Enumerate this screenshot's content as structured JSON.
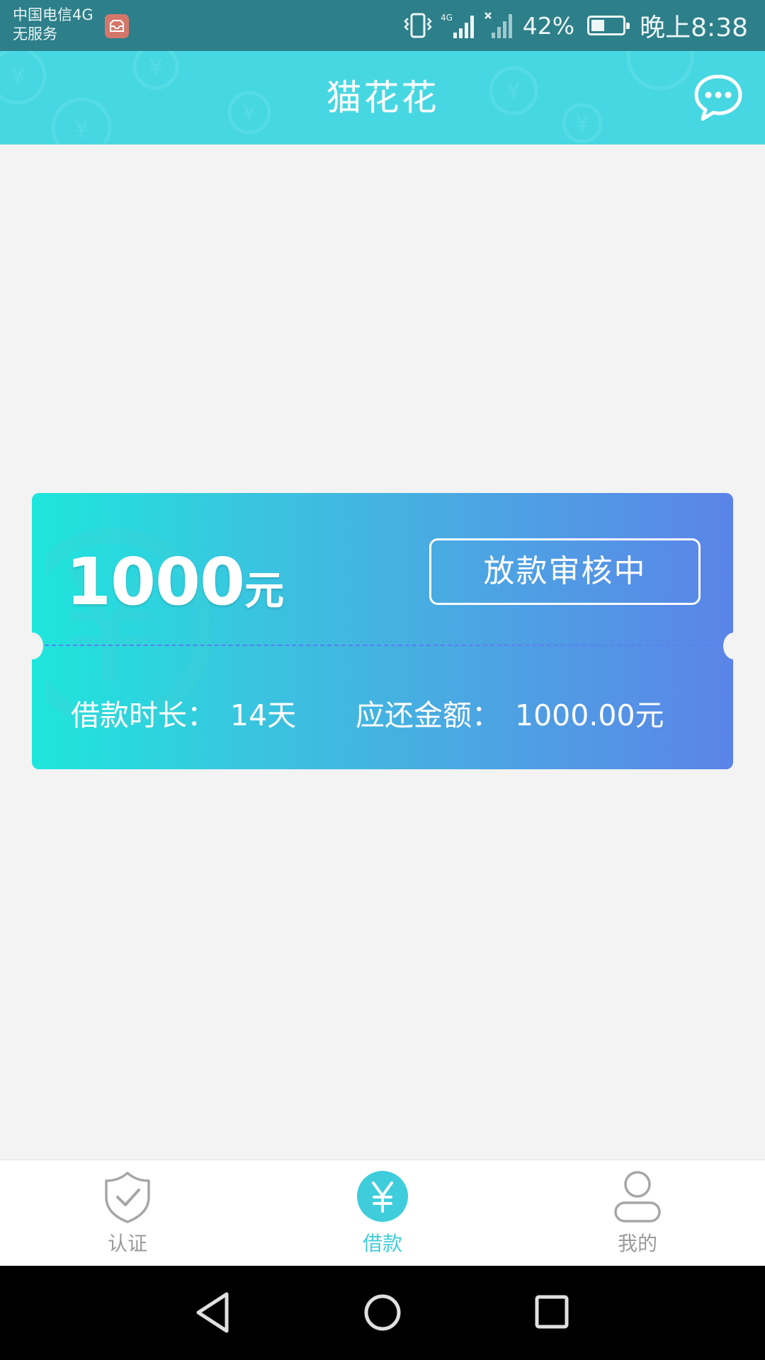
{
  "status_bar": {
    "carrier_line1": "中国电信4G",
    "carrier_line2": "无服务",
    "network": "4G",
    "battery_percent": "42%",
    "battery_level": 0.42,
    "time": "晚上8:38"
  },
  "header": {
    "title": "猫花花",
    "chat_icon": "chat-bubble-icon",
    "background_color": "#47d7e2"
  },
  "loan_card": {
    "amount": "1000",
    "amount_unit": "元",
    "status_label": "放款审核中",
    "term_label": "借款时长：",
    "term_value": "14天",
    "due_label": "应还金额：",
    "due_value": "1000.00元",
    "gradient_start": "#1ee6dc",
    "gradient_end": "#5b84e8"
  },
  "tab_bar": {
    "tabs": [
      {
        "label": "认证",
        "icon": "shield-check-icon",
        "active": false
      },
      {
        "label": "借款",
        "icon": "yen-icon",
        "active": true
      },
      {
        "label": "我的",
        "icon": "user-icon",
        "active": false
      }
    ],
    "active_color": "#3fcddb",
    "inactive_color": "#9b9b9b"
  },
  "nav_bar": {
    "back_icon": "back-triangle-icon",
    "home_icon": "home-circle-icon",
    "recent_icon": "recent-square-icon"
  }
}
